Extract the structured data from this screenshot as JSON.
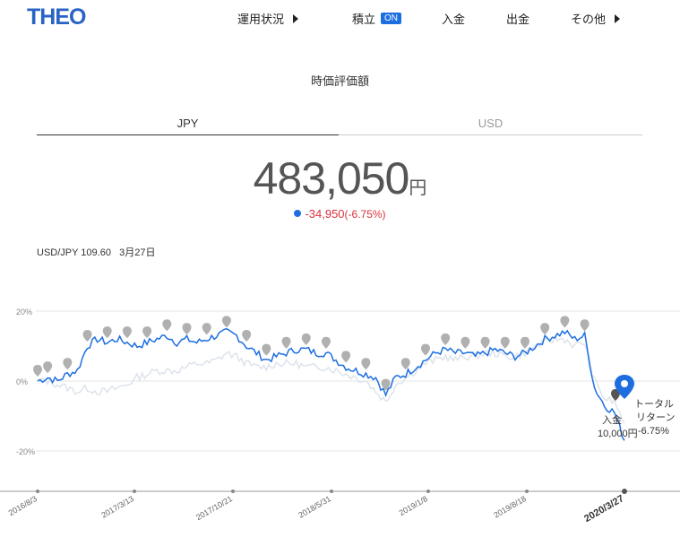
{
  "header": {
    "logo": "THEO",
    "nav": [
      {
        "label": "運用状況",
        "arrow": true
      },
      {
        "label": "積立",
        "badge": "ON"
      },
      {
        "label": "入金"
      },
      {
        "label": "出金"
      },
      {
        "label": "その他",
        "arrow": true
      }
    ]
  },
  "summary": {
    "title": "時価評価額",
    "tabs": {
      "jpy": "JPY",
      "usd": "USD",
      "active": "JPY"
    },
    "value": "483,050",
    "unit": "円",
    "change": "-34,950",
    "change_pct": "(-6.75%)"
  },
  "fx": {
    "label": "USD/JPY 109.60",
    "date": "3月27日"
  },
  "colors": {
    "accent": "#1d6fe0",
    "negative": "#d9323c",
    "benchmark": "#dde3ec",
    "marker": "#a9a9a9"
  },
  "chart_data": {
    "type": "line",
    "ylim": [
      -25,
      25
    ],
    "yticks": [
      "20%",
      "0%",
      "-20%"
    ],
    "ytick_values": [
      20,
      0,
      -20
    ],
    "x_labels": [
      "2016/8/3",
      "2017/3/13",
      "2017/10/21",
      "2018/5/31",
      "2019/1/8",
      "2019/8/18",
      "2020/3/27"
    ],
    "series": [
      {
        "values": [
          0,
          1,
          0,
          2,
          3,
          10,
          12,
          11,
          12,
          11,
          10,
          11,
          12,
          13,
          11,
          12,
          11,
          12,
          13,
          14,
          13,
          10,
          8,
          6,
          7,
          8,
          9,
          9,
          8,
          8,
          6,
          4,
          3,
          2,
          1,
          -4,
          1,
          2,
          4,
          6,
          8,
          9,
          8,
          8,
          7,
          8,
          9,
          8,
          7,
          8,
          10,
          12,
          13,
          14,
          12,
          13,
          -2,
          -7,
          -9,
          -17
        ]
      },
      {
        "values": [
          0,
          0,
          -1,
          -2,
          -3,
          -2,
          -3,
          -3,
          -2,
          -1,
          1,
          2,
          3,
          3,
          3,
          4,
          5,
          5,
          6,
          8,
          7,
          5,
          4,
          4,
          5,
          5,
          5,
          4,
          4,
          4,
          3,
          2,
          1,
          0,
          -3,
          -6,
          -1,
          1,
          3,
          5,
          6,
          7,
          6,
          7,
          7,
          8,
          8,
          7,
          7,
          8,
          10,
          11,
          12,
          12,
          10,
          11,
          0,
          -5,
          -6,
          -12
        ]
      }
    ],
    "annotations": {
      "deposit_label": "入金",
      "deposit_amount": "10,000円",
      "total_return_label_1": "トータル",
      "total_return_label_2": "リターン",
      "total_return_value": "-6.75%"
    }
  }
}
